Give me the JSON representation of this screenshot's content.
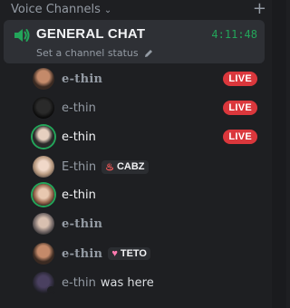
{
  "header": {
    "title": "Voice Channels",
    "chevron_icon": "chevron-down-icon",
    "add_icon": "plus-icon"
  },
  "channel": {
    "icon": "speaker-icon",
    "name": "GENERAL CHAT",
    "timer": "4:11:48",
    "status_placeholder": "Set a channel status",
    "status_icon": "pencil-icon"
  },
  "members": [
    {
      "name": "e-thin",
      "live": "LIVE",
      "style": "fancy"
    },
    {
      "name": "e-thin",
      "live": "LIVE"
    },
    {
      "name": "e-thin",
      "live": "LIVE",
      "speaking": true
    },
    {
      "name": "E-thin",
      "tag": "CABZ",
      "tag_icon": "fire-icon"
    },
    {
      "name": "e-thin",
      "speaking": true
    },
    {
      "name": "e-thin",
      "style": "fancy"
    },
    {
      "name": "e-thin",
      "style": "fancy",
      "tag": "TETO",
      "tag_icon": "heart-icon"
    },
    {
      "name": "e-thin",
      "suffix": "was here",
      "muted": true
    }
  ],
  "colors": {
    "live": "#da373c",
    "speaking": "#23a55a",
    "timer": "#23a55a"
  }
}
